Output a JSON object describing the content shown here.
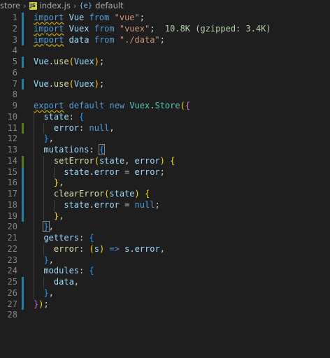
{
  "breadcrumb": {
    "folder": "store",
    "file": "index.js",
    "file_icon": "JS",
    "symbol": "default",
    "symbol_icon": "{e}"
  },
  "code_lines": [
    {
      "n": "1",
      "gutter": "mod",
      "tokens": [
        {
          "t": "import",
          "c": "kw",
          "sq": 1
        },
        {
          "t": " Vue ",
          "c": "var"
        },
        {
          "t": "from",
          "c": "kw"
        },
        {
          "t": " ",
          "c": "pl"
        },
        {
          "t": "\"vue\"",
          "c": "str"
        },
        {
          "t": ";",
          "c": "pl"
        }
      ]
    },
    {
      "n": "2",
      "gutter": "mod",
      "tokens": [
        {
          "t": "import",
          "c": "kw",
          "sq": 1
        },
        {
          "t": " Vuex ",
          "c": "var"
        },
        {
          "t": "from",
          "c": "kw"
        },
        {
          "t": " ",
          "c": "pl"
        },
        {
          "t": "\"vuex\"",
          "c": "str"
        },
        {
          "t": ";",
          "c": "pl"
        },
        {
          "t": "  10.8K (gzipped: 3.4K)",
          "c": "size"
        }
      ]
    },
    {
      "n": "3",
      "gutter": "mod",
      "tokens": [
        {
          "t": "import",
          "c": "kw",
          "sq": 1
        },
        {
          "t": " data ",
          "c": "var"
        },
        {
          "t": "from",
          "c": "kw"
        },
        {
          "t": " ",
          "c": "pl"
        },
        {
          "t": "\"./data\"",
          "c": "str"
        },
        {
          "t": ";",
          "c": "pl"
        }
      ]
    },
    {
      "n": "4",
      "gutter": "",
      "tokens": []
    },
    {
      "n": "5",
      "gutter": "mod",
      "tokens": [
        {
          "t": "Vue",
          "c": "var"
        },
        {
          "t": ".",
          "c": "pl"
        },
        {
          "t": "use",
          "c": "fn"
        },
        {
          "t": "(",
          "c": "br1"
        },
        {
          "t": "Vuex",
          "c": "var"
        },
        {
          "t": ")",
          "c": "br1"
        },
        {
          "t": ";",
          "c": "pl"
        }
      ]
    },
    {
      "n": "6",
      "gutter": "",
      "tokens": []
    },
    {
      "n": "7",
      "gutter": "mod",
      "tokens": [
        {
          "t": "Vue",
          "c": "var"
        },
        {
          "t": ".",
          "c": "pl"
        },
        {
          "t": "use",
          "c": "fn"
        },
        {
          "t": "(",
          "c": "br1"
        },
        {
          "t": "Vuex",
          "c": "var"
        },
        {
          "t": ")",
          "c": "br1"
        },
        {
          "t": ";",
          "c": "pl"
        }
      ]
    },
    {
      "n": "8",
      "gutter": "",
      "tokens": []
    },
    {
      "n": "9",
      "gutter": "",
      "tokens": [
        {
          "t": "export",
          "c": "kw",
          "sq": 1
        },
        {
          "t": " ",
          "c": "pl"
        },
        {
          "t": "default",
          "c": "kw"
        },
        {
          "t": " ",
          "c": "pl"
        },
        {
          "t": "new",
          "c": "kw"
        },
        {
          "t": " ",
          "c": "pl"
        },
        {
          "t": "Vuex",
          "c": "cls"
        },
        {
          "t": ".",
          "c": "pl"
        },
        {
          "t": "Store",
          "c": "cls"
        },
        {
          "t": "(",
          "c": "br1"
        },
        {
          "t": "{",
          "c": "br2"
        }
      ]
    },
    {
      "n": "10",
      "gutter": "",
      "tokens": [
        {
          "t": "  state",
          "c": "var"
        },
        {
          "t": ": ",
          "c": "pl"
        },
        {
          "t": "{",
          "c": "br3"
        }
      ]
    },
    {
      "n": "11",
      "gutter": "add",
      "tokens": [
        {
          "t": "    error",
          "c": "var"
        },
        {
          "t": ": ",
          "c": "pl"
        },
        {
          "t": "null",
          "c": "kw"
        },
        {
          "t": ",",
          "c": "pl"
        }
      ]
    },
    {
      "n": "12",
      "gutter": "",
      "tokens": [
        {
          "t": "  ",
          "c": "pl"
        },
        {
          "t": "}",
          "c": "br3"
        },
        {
          "t": ",",
          "c": "pl"
        }
      ]
    },
    {
      "n": "13",
      "gutter": "",
      "tokens": [
        {
          "t": "  mutations",
          "c": "var"
        },
        {
          "t": ": ",
          "c": "pl"
        },
        {
          "t": "{",
          "c": "br3",
          "box": 1
        }
      ]
    },
    {
      "n": "14",
      "gutter": "add",
      "tokens": [
        {
          "t": "    ",
          "c": "pl"
        },
        {
          "t": "setError",
          "c": "fn"
        },
        {
          "t": "(",
          "c": "br1"
        },
        {
          "t": "state",
          "c": "var"
        },
        {
          "t": ", ",
          "c": "pl"
        },
        {
          "t": "error",
          "c": "var"
        },
        {
          "t": ")",
          "c": "br1"
        },
        {
          "t": " ",
          "c": "pl"
        },
        {
          "t": "{",
          "c": "br1"
        }
      ]
    },
    {
      "n": "15",
      "gutter": "mod",
      "tokens": [
        {
          "t": "      state",
          "c": "var"
        },
        {
          "t": ".",
          "c": "pl"
        },
        {
          "t": "error",
          "c": "var"
        },
        {
          "t": " = ",
          "c": "pl"
        },
        {
          "t": "error",
          "c": "var"
        },
        {
          "t": ";",
          "c": "pl"
        }
      ]
    },
    {
      "n": "16",
      "gutter": "mod",
      "tokens": [
        {
          "t": "    ",
          "c": "pl"
        },
        {
          "t": "}",
          "c": "br1"
        },
        {
          "t": ",",
          "c": "pl"
        }
      ]
    },
    {
      "n": "17",
      "gutter": "mod",
      "tokens": [
        {
          "t": "    ",
          "c": "pl"
        },
        {
          "t": "clearError",
          "c": "fn"
        },
        {
          "t": "(",
          "c": "br1"
        },
        {
          "t": "state",
          "c": "var"
        },
        {
          "t": ")",
          "c": "br1"
        },
        {
          "t": " ",
          "c": "pl"
        },
        {
          "t": "{",
          "c": "br1"
        }
      ]
    },
    {
      "n": "18",
      "gutter": "mod",
      "tokens": [
        {
          "t": "      state",
          "c": "var"
        },
        {
          "t": ".",
          "c": "pl"
        },
        {
          "t": "error",
          "c": "var"
        },
        {
          "t": " = ",
          "c": "pl"
        },
        {
          "t": "null",
          "c": "kw"
        },
        {
          "t": ";",
          "c": "pl"
        }
      ]
    },
    {
      "n": "19",
      "gutter": "mod",
      "tokens": [
        {
          "t": "    ",
          "c": "pl"
        },
        {
          "t": "}",
          "c": "br1"
        },
        {
          "t": ",",
          "c": "pl"
        }
      ]
    },
    {
      "n": "20",
      "gutter": "",
      "tokens": [
        {
          "t": "  ",
          "c": "pl"
        },
        {
          "t": "}",
          "c": "br3",
          "box": 1
        },
        {
          "t": ",",
          "c": "pl"
        }
      ]
    },
    {
      "n": "21",
      "gutter": "",
      "tokens": [
        {
          "t": "  getters",
          "c": "var"
        },
        {
          "t": ": ",
          "c": "pl"
        },
        {
          "t": "{",
          "c": "br3"
        }
      ]
    },
    {
      "n": "22",
      "gutter": "",
      "tokens": [
        {
          "t": "    ",
          "c": "pl"
        },
        {
          "t": "error",
          "c": "fn"
        },
        {
          "t": ": ",
          "c": "pl"
        },
        {
          "t": "(",
          "c": "br1"
        },
        {
          "t": "s",
          "c": "var"
        },
        {
          "t": ")",
          "c": "br1"
        },
        {
          "t": " ",
          "c": "pl"
        },
        {
          "t": "=>",
          "c": "kw"
        },
        {
          "t": " s",
          "c": "var"
        },
        {
          "t": ".",
          "c": "pl"
        },
        {
          "t": "error",
          "c": "var"
        },
        {
          "t": ",",
          "c": "pl"
        }
      ]
    },
    {
      "n": "23",
      "gutter": "",
      "tokens": [
        {
          "t": "  ",
          "c": "pl"
        },
        {
          "t": "}",
          "c": "br3"
        },
        {
          "t": ",",
          "c": "pl"
        }
      ]
    },
    {
      "n": "24",
      "gutter": "",
      "tokens": [
        {
          "t": "  modules",
          "c": "var"
        },
        {
          "t": ": ",
          "c": "pl"
        },
        {
          "t": "{",
          "c": "br3"
        }
      ]
    },
    {
      "n": "25",
      "gutter": "mod",
      "tokens": [
        {
          "t": "    data",
          "c": "var"
        },
        {
          "t": ",",
          "c": "pl"
        }
      ]
    },
    {
      "n": "26",
      "gutter": "mod",
      "tokens": [
        {
          "t": "  ",
          "c": "pl"
        },
        {
          "t": "}",
          "c": "br3"
        },
        {
          "t": ",",
          "c": "pl"
        }
      ]
    },
    {
      "n": "27",
      "gutter": "mod",
      "tokens": [
        {
          "t": "}",
          "c": "br2"
        },
        {
          "t": ")",
          "c": "br1"
        },
        {
          "t": ";",
          "c": "pl"
        }
      ]
    },
    {
      "n": "28",
      "gutter": "",
      "tokens": []
    }
  ],
  "colors": {
    "background": "#1e1e1e",
    "keyword": "#569cd6",
    "string": "#ce9178",
    "variable": "#9cdcfe",
    "function": "#dcdcaa",
    "class": "#4ec9b0",
    "gutter_modified": "#1b81a8",
    "gutter_added": "#587c0c",
    "squiggle": "#cca700"
  }
}
